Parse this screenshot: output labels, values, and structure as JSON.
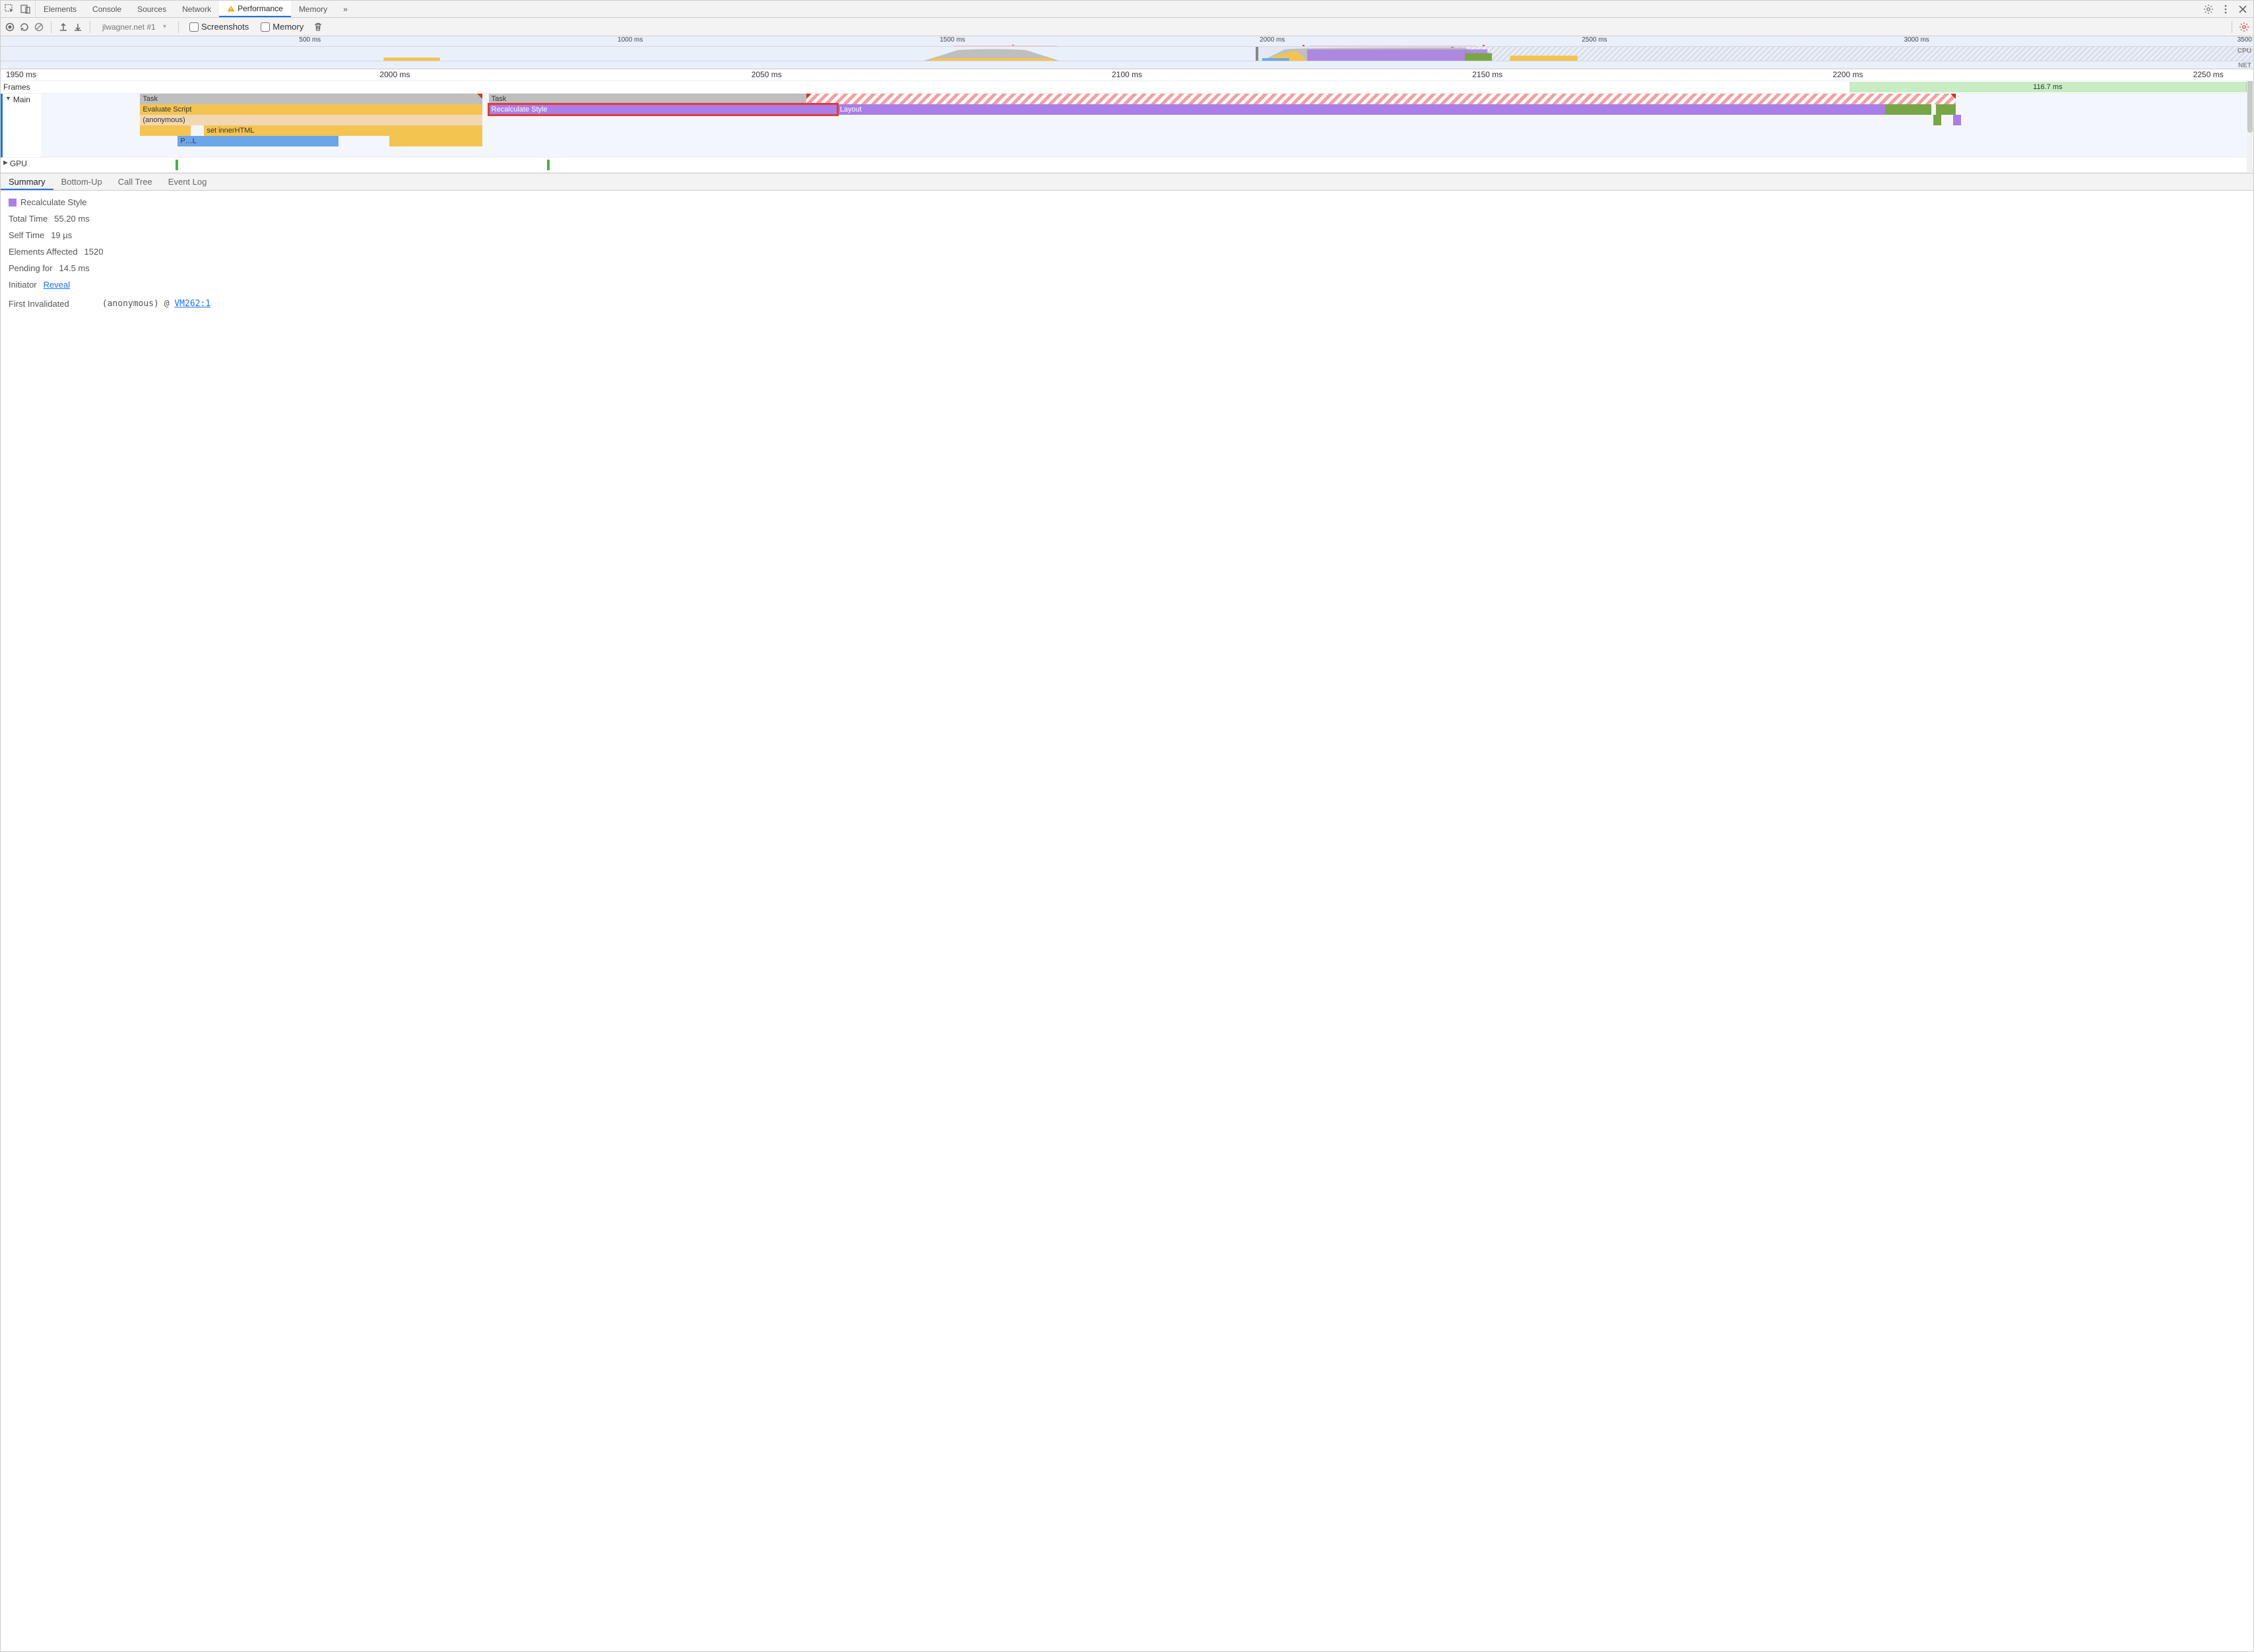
{
  "tabs": {
    "items": [
      "Elements",
      "Console",
      "Sources",
      "Network",
      "Performance",
      "Memory"
    ],
    "activeIndex": 4,
    "overflow": "»"
  },
  "toolbar": {
    "session": "jlwagner.net #1",
    "screenshots_label": "Screenshots",
    "memory_label": "Memory"
  },
  "overview": {
    "ticks": [
      "500 ms",
      "1000 ms",
      "1500 ms",
      "2000 ms",
      "2500 ms",
      "3000 ms"
    ],
    "end_label": "3500",
    "cpu_label": "CPU",
    "net_label": "NET"
  },
  "flame": {
    "ruler": [
      "1950 ms",
      "2000 ms",
      "2050 ms",
      "2100 ms",
      "2150 ms",
      "2200 ms",
      "2250 ms"
    ],
    "lanes": {
      "frames": {
        "label": "Frames",
        "block_label": "116.7 ms"
      },
      "main": {
        "label": "Main",
        "row0": {
          "task1": "Task",
          "task2": "Task"
        },
        "row1": {
          "eval": "Evaluate Script",
          "recalc": "Recalculate Style",
          "layout": "Layout"
        },
        "row2": {
          "anon": "(anonymous)"
        },
        "row3": {
          "inner": "set innerHTML"
        },
        "row4": {
          "pl": "P…L"
        }
      },
      "gpu": {
        "label": "GPU"
      }
    }
  },
  "bottom_tabs": {
    "items": [
      "Summary",
      "Bottom-Up",
      "Call Tree",
      "Event Log"
    ],
    "activeIndex": 0
  },
  "summary": {
    "title": "Recalculate Style",
    "total_time": {
      "k": "Total Time",
      "v": "55.20 ms"
    },
    "self_time": {
      "k": "Self Time",
      "v": "19 µs"
    },
    "elements_affected": {
      "k": "Elements Affected",
      "v": "1520"
    },
    "pending_for": {
      "k": "Pending for",
      "v": "14.5 ms"
    },
    "initiator": {
      "k": "Initiator",
      "link": "Reveal"
    },
    "first_invalidated": {
      "k": "First Invalidated",
      "anon": "(anonymous)",
      "at": "@",
      "loc": "VM262:1"
    }
  }
}
